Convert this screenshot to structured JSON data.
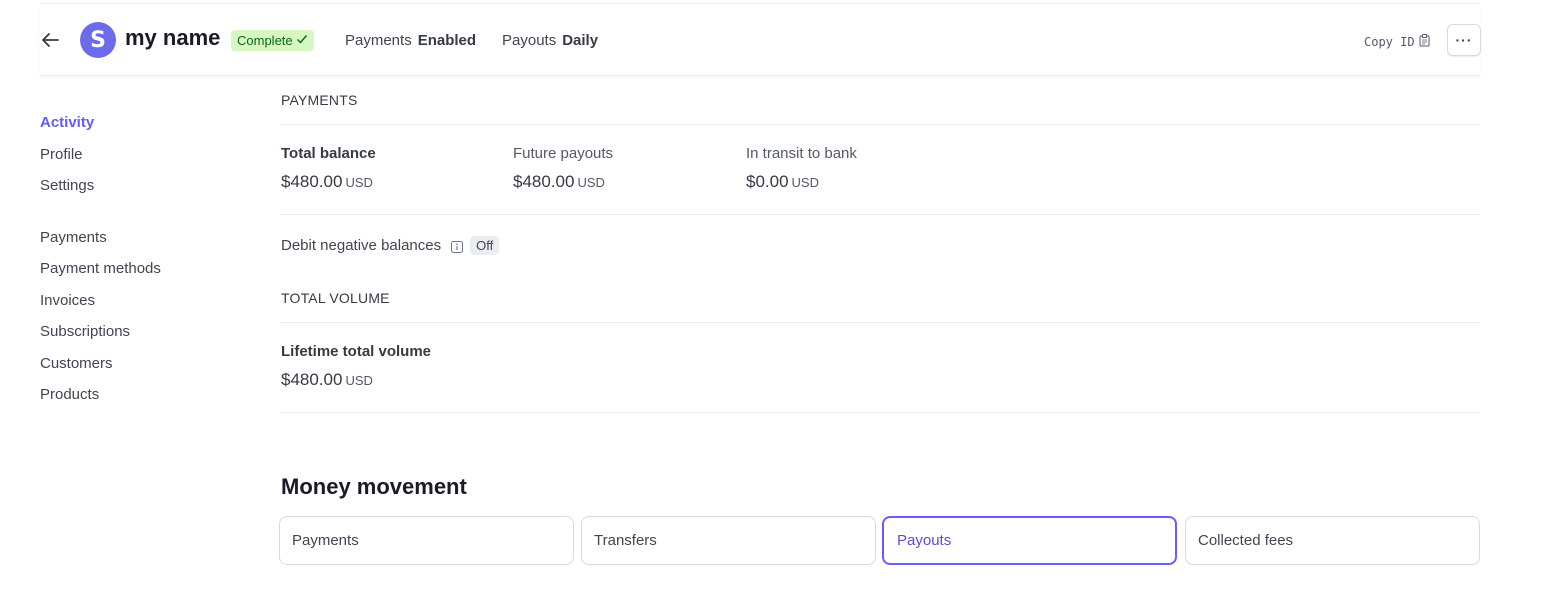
{
  "header": {
    "avatar_initial": "S",
    "account_name": "my name",
    "status_badge": "Complete",
    "payments_label": "Payments",
    "payments_value": "Enabled",
    "payouts_label": "Payouts",
    "payouts_value": "Daily",
    "copy_id_label": "Copy ID",
    "more_label": "···"
  },
  "sidebar": {
    "group1": [
      "Activity",
      "Profile",
      "Settings"
    ],
    "group2": [
      "Payments",
      "Payment methods",
      "Invoices",
      "Subscriptions",
      "Customers",
      "Products"
    ],
    "active": "Activity"
  },
  "payments": {
    "title": "PAYMENTS",
    "total_balance": {
      "label": "Total balance",
      "amount": "$480.00",
      "currency": "USD"
    },
    "future_payouts": {
      "label": "Future payouts",
      "amount": "$480.00",
      "currency": "USD"
    },
    "in_transit": {
      "label": "In transit to bank",
      "amount": "$0.00",
      "currency": "USD"
    },
    "debit_label": "Debit negative balances",
    "debit_state": "Off"
  },
  "volume": {
    "title": "TOTAL VOLUME",
    "lifetime": {
      "label": "Lifetime total volume",
      "amount": "$480.00",
      "currency": "USD"
    }
  },
  "money_movement": {
    "title": "Money movement",
    "tabs": [
      "Payments",
      "Transfers",
      "Payouts",
      "Collected fees"
    ],
    "selected": "Payouts"
  },
  "colors": {
    "accent": "#635bff",
    "avatar": "#6c6bea",
    "badge_bg": "#d7f7c2",
    "badge_text": "#05690d"
  }
}
